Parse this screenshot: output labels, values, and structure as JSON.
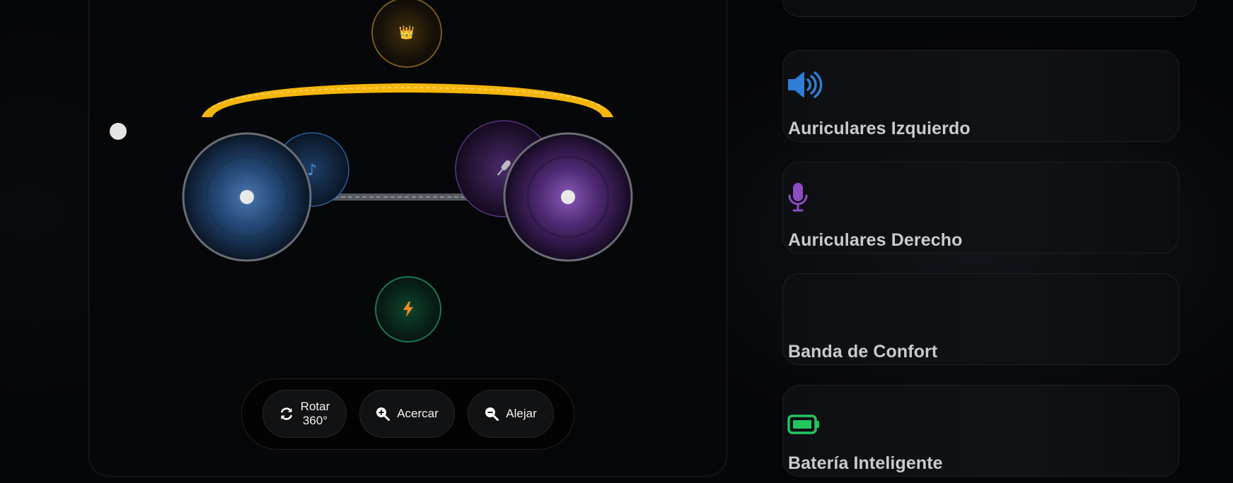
{
  "controls": {
    "rotate_label_line1": "Rotar",
    "rotate_label_line2": "360°",
    "zoom_in_label": "Acercar",
    "zoom_out_label": "Alejar"
  },
  "viewer": {
    "crown_icon": "crown-emoji",
    "left_cup_icon": "music-note-icon",
    "right_cup_icon": "microphone-icon",
    "bottom_icon": "lightning-icon",
    "headband_color": "#f5b60c",
    "left_color": "#2a5a9a",
    "right_color": "#7a3fa8",
    "power_color": "#1a7a50"
  },
  "cards": [
    {
      "title": "Auriculares Izquierdo",
      "icon": "speaker-volume-icon",
      "icon_color": "#2f7fd4"
    },
    {
      "title": "Auriculares Derecho",
      "icon": "microphone-icon",
      "icon_color": "#8e4bc4"
    },
    {
      "title": "Banda de Confort",
      "icon": "",
      "icon_color": ""
    },
    {
      "title": "Batería Inteligente",
      "icon": "battery-full-icon",
      "icon_color": "#22c55e"
    }
  ]
}
